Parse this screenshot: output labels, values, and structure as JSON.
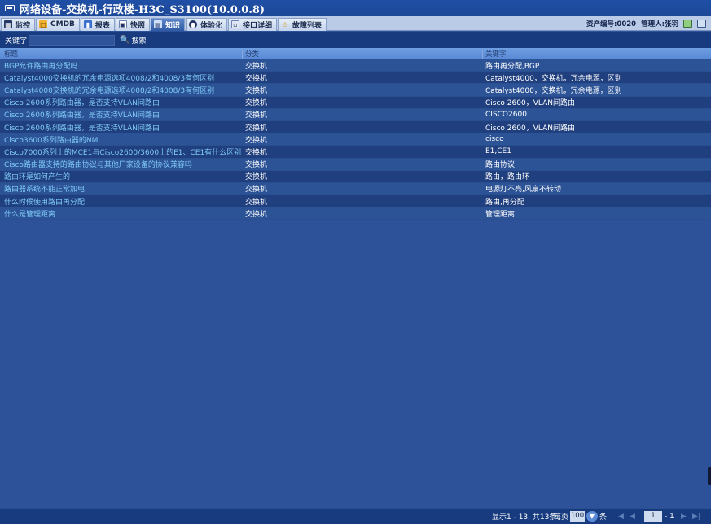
{
  "window": {
    "title": "网络设备-交换机-行政楼-H3C_S3100(10.0.0.8)"
  },
  "tabs": [
    {
      "label": "监控",
      "icon": "monitor-icon",
      "active": false
    },
    {
      "label": "CMDB",
      "icon": "cmdb-icon",
      "active": false
    },
    {
      "label": "报表",
      "icon": "report-icon",
      "active": false
    },
    {
      "label": "快照",
      "icon": "snapshot-icon",
      "active": false
    },
    {
      "label": "知识",
      "icon": "knowledge-icon",
      "active": true
    },
    {
      "label": "体验化",
      "icon": "experience-icon",
      "active": false
    },
    {
      "label": "接口详细",
      "icon": "interface-icon",
      "active": false
    },
    {
      "label": "故障列表",
      "icon": "warning-icon",
      "active": false
    }
  ],
  "header_right": {
    "asset_no": "资产编号:0020",
    "admin": "管理人:张羽"
  },
  "search": {
    "label": "关键字",
    "value": "",
    "button_label": "搜索"
  },
  "table": {
    "columns": [
      "标题",
      "分类",
      "关键字"
    ],
    "rows": [
      {
        "title": "BGP允许路由再分配吗",
        "category": "交换机",
        "keywords": "路由再分配,BGP"
      },
      {
        "title": "Catalyst4000交换机的冗余电源选项4008/2和4008/3有何区别",
        "category": "交换机",
        "keywords": "Catalyst4000，交换机，冗余电源，区别"
      },
      {
        "title": "Catalyst4000交换机的冗余电源选项4008/2和4008/3有何区别",
        "category": "交换机",
        "keywords": "Catalyst4000，交换机，冗余电源，区别"
      },
      {
        "title": "Cisco 2600系列路由器，是否支持VLAN间路由",
        "category": "交换机",
        "keywords": "Cisco 2600，VLAN间路由"
      },
      {
        "title": "Cisco 2600系列路由器，是否支持VLAN间路由",
        "category": "交换机",
        "keywords": "CISCO2600"
      },
      {
        "title": "Cisco 2600系列路由器，是否支持VLAN间路由",
        "category": "交换机",
        "keywords": "Cisco 2600，VLAN间路由"
      },
      {
        "title": "Cisco3600系列路由器的NM",
        "category": "交换机",
        "keywords": "cisco"
      },
      {
        "title": "Cisco7000系列上的MCE1与Cisco2600/3600上的E1、CE1有什么区别",
        "category": "交换机",
        "keywords": "E1,CE1"
      },
      {
        "title": "Cisco路由器支持的路由协议与其他厂家设备的协议兼容吗",
        "category": "交换机",
        "keywords": "路由协议"
      },
      {
        "title": "路由环是如何产生的",
        "category": "交换机",
        "keywords": "路由，路由环"
      },
      {
        "title": "路由器系统不能正常加电",
        "category": "交换机",
        "keywords": "电源灯不亮,风扇不转动"
      },
      {
        "title": "什么时候使用路由再分配",
        "category": "交换机",
        "keywords": "路由,再分配"
      },
      {
        "title": "什么是管理距离",
        "category": "交换机",
        "keywords": "管理距离"
      }
    ]
  },
  "footer": {
    "display_text": "显示1 - 13, 共13条",
    "per_page_label": "每页",
    "per_page_value": "100",
    "per_page_unit": "条",
    "page_value": "1",
    "page_total": "- 1"
  }
}
